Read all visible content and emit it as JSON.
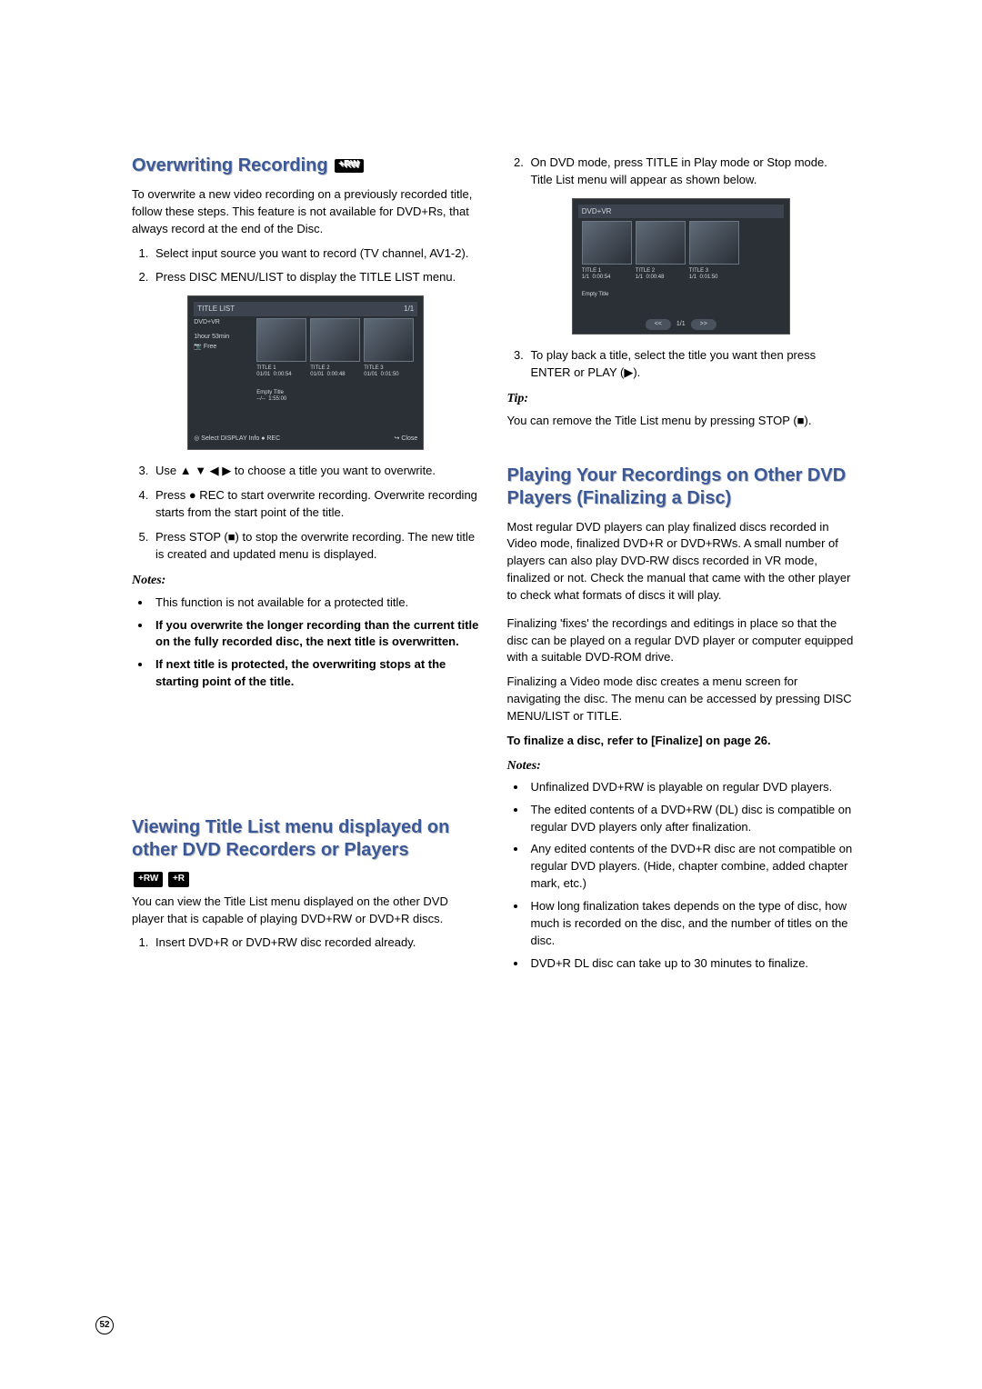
{
  "page_number": "52",
  "left": {
    "heading1": "Overwriting Recording",
    "heading1_badge": "+RW",
    "intro1": "To overwrite a new video recording on a previously recorded title, follow these steps. This feature is not available for DVD+Rs, that always record at the end of the Disc.",
    "steps1": {
      "s1": "Select input source you want to record (TV channel, AV1-2).",
      "s2": "Press DISC MENU/LIST to display the TITLE LIST menu."
    },
    "screenshot1": {
      "header": "TITLE LIST",
      "page": "1/1",
      "side_top": "DVD+VR",
      "side_rec": "1hour 53min",
      "side_free": "Free",
      "t1": "TITLE 1",
      "t1b": "01/01",
      "t1c": "0:00:54",
      "t2": "TITLE 2",
      "t2b": "01/01",
      "t2c": "0:00:48",
      "t3": "TITLE 3",
      "t3b": "01/01",
      "t3c": "0:01:50",
      "empty": "Empty Title",
      "empty_time": "1:55:00",
      "bottom_left": "◎ Select   DISPLAY Info  ● REC",
      "bottom_right": "↪ Close"
    },
    "steps2": {
      "s3": "Use ▲ ▼ ◀ ▶ to choose a title you want to overwrite.",
      "s4": "Press ● REC to start overwrite recording. Overwrite recording starts from the start point of the title.",
      "s5": "Press STOP (■) to stop the overwrite recording. The new title is created and updated menu is displayed."
    },
    "notes_label": "Notes:",
    "notes": {
      "n1": "This function is not available for a protected title.",
      "n2": "If you overwrite the longer recording than the current title on the fully recorded disc, the next title is overwritten.",
      "n3": "If next title is protected, the overwriting stops at the starting point of the title."
    },
    "heading2": "Viewing Title List menu displayed on other DVD Recorders or Players",
    "heading2_badge1": "+RW",
    "heading2_badge2": "+R",
    "intro2": "You can view the Title List menu displayed on the other DVD player that is capable of playing DVD+RW or DVD+R discs.",
    "steps3": {
      "s1": "Insert DVD+R or DVD+RW disc recorded already."
    }
  },
  "right": {
    "steps1": {
      "s2a": "On DVD mode, press TITLE in Play mode or Stop mode.",
      "s2b": "Title List menu will appear as shown below."
    },
    "screenshot2": {
      "header": "DVD+VR",
      "t1": "TITLE 1",
      "t1b": "1/1",
      "t1c": "0:00:54",
      "t2": "TITLE 2",
      "t2b": "1/1",
      "t2c": "0:00:48",
      "t3": "TITLE 3",
      "t3b": "1/1",
      "t3c": "0:01:50",
      "empty": "Empty Title",
      "nav_left": "<<",
      "nav_mid": "1/1",
      "nav_right": ">>"
    },
    "steps2": {
      "s3": "To play back a title, select the title you want then press ENTER or PLAY (▶)."
    },
    "tip_label": "Tip:",
    "tip": "You can remove the Title List menu by pressing STOP (■).",
    "heading3": "Playing Your Recordings on Other DVD Players (Finalizing a Disc)",
    "para1": "Most regular DVD players can play finalized discs recorded in Video mode, finalized DVD+R or DVD+RWs. A small number of players can also play DVD-RW discs recorded in VR mode, finalized or not. Check the manual that came with the other player to check what formats of discs it will play.",
    "para2": "Finalizing 'fixes' the recordings and editings in place so that the disc can be played on a regular DVD player or computer equipped with a suitable DVD-ROM drive.",
    "para3": "Finalizing a Video mode disc creates a menu screen for navigating the disc. The menu can be accessed by pressing DISC MENU/LIST or TITLE.",
    "para4_bold": "To finalize a disc, refer to [Finalize] on page 26.",
    "notes_label": "Notes:",
    "notes": {
      "n1": "Unfinalized DVD+RW is playable on regular DVD players.",
      "n2": "The edited contents of a DVD+RW (DL) disc is compatible on regular DVD players only after finalization.",
      "n3": "Any edited contents of the DVD+R disc are not compatible on regular DVD players. (Hide, chapter combine, added chapter mark, etc.)",
      "n4": "How long finalization takes depends on the type of disc, how much is recorded on the disc, and the number of titles on the disc.",
      "n5": "DVD+R DL disc can take up to 30 minutes to finalize."
    }
  }
}
